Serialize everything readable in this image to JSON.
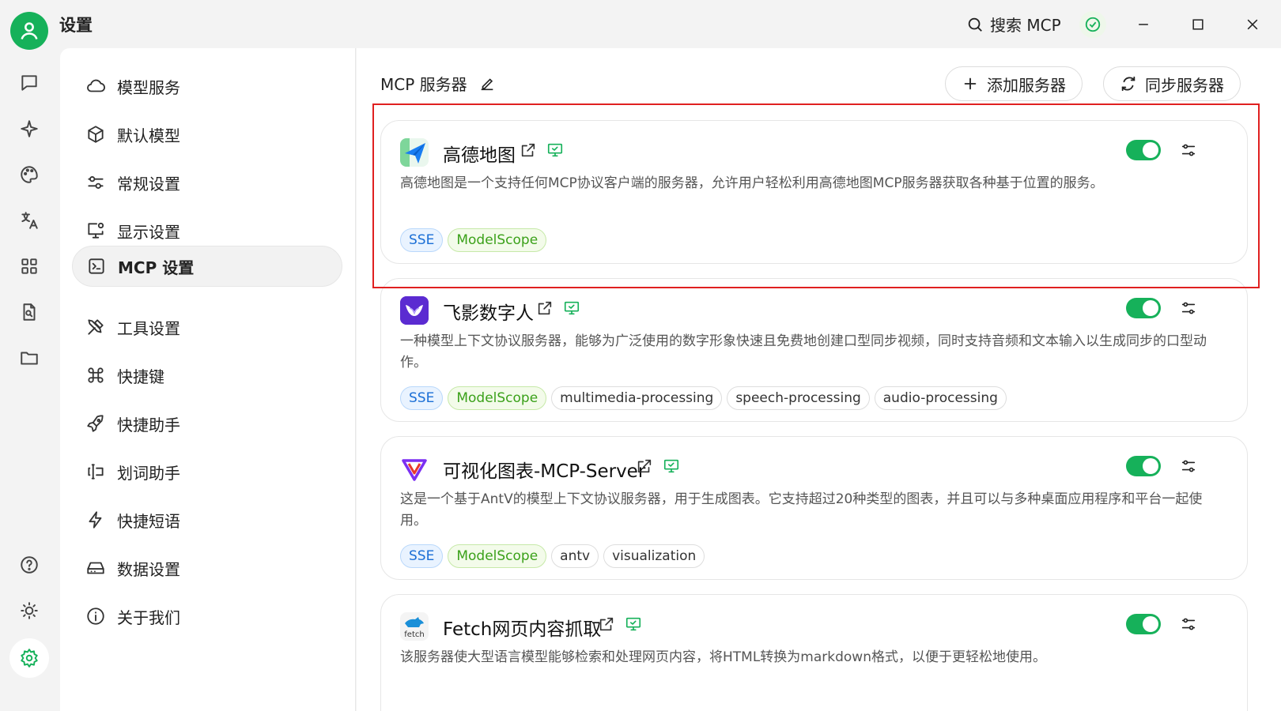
{
  "app": {
    "title": "设置"
  },
  "titlebar": {
    "search_label": "搜索 MCP"
  },
  "menu": {
    "items": [
      {
        "label": "模型服务",
        "icon": "cloud-icon"
      },
      {
        "label": "默认模型",
        "icon": "cube-icon"
      },
      {
        "label": "常规设置",
        "icon": "sliders-icon"
      },
      {
        "label": "显示设置",
        "icon": "monitor-gear-icon"
      },
      {
        "label": "MCP 设置",
        "icon": "terminal-icon",
        "active": true
      },
      {
        "label": "工具设置",
        "icon": "tools-icon"
      },
      {
        "label": "快捷键",
        "icon": "command-icon"
      },
      {
        "label": "快捷助手",
        "icon": "rocket-icon"
      },
      {
        "label": "划词助手",
        "icon": "text-cursor-icon"
      },
      {
        "label": "快捷短语",
        "icon": "zap-icon"
      },
      {
        "label": "数据设置",
        "icon": "hard-drive-icon"
      },
      {
        "label": "关于我们",
        "icon": "info-icon"
      }
    ]
  },
  "main": {
    "title": "MCP 服务器",
    "add_label": "添加服务器",
    "sync_label": "同步服务器"
  },
  "servers": [
    {
      "name": "高德地图",
      "description": "高德地图是一个支持任何MCP协议客户端的服务器，允许用户轻松利用高德地图MCP服务器获取各种基于位置的服务。",
      "tags": [
        "SSE",
        "ModelScope"
      ],
      "enabled": true
    },
    {
      "name": "飞影数字人",
      "description": "一种模型上下文协议服务器，能够为广泛使用的数字形象快速且免费地创建口型同步视频，同时支持音频和文本输入以生成同步的口型动作。",
      "tags": [
        "SSE",
        "ModelScope",
        "multimedia-processing",
        "speech-processing",
        "audio-processing"
      ],
      "enabled": true
    },
    {
      "name": "可视化图表-MCP-Server",
      "description": "这是一个基于AntV的模型上下文协议服务器，用于生成图表。它支持超过20种类型的图表，并且可以与多种桌面应用程序和平台一起使用。",
      "tags": [
        "SSE",
        "ModelScope",
        "antv",
        "visualization"
      ],
      "enabled": true
    },
    {
      "name": "Fetch网页内容抓取",
      "description": "该服务器使大型语言模型能够检索和处理网页内容，将HTML转换为markdown格式，以便于更轻松地使用。",
      "tags": [],
      "enabled": true,
      "logo_text": "fetch"
    }
  ],
  "colors": {
    "accent": "#16b15a",
    "highlight": "#e02020",
    "sse": "#1b6fd6",
    "modelscope": "#3ba11a"
  }
}
